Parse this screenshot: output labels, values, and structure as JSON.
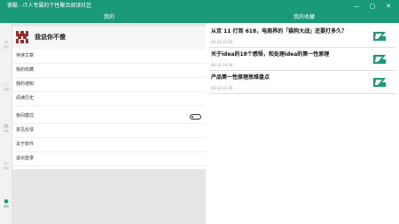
{
  "window": {
    "title": "掌酷 - IT人专属的个性聚合阅读社区",
    "minimize_glyph": "—",
    "maximize_glyph": "▢",
    "close_glyph": "✕"
  },
  "header": {
    "left_title": "我的",
    "right_title": "我的收藏"
  },
  "nav": {
    "items": [
      {
        "label": "首页",
        "icon": "home-icon"
      },
      {
        "label": "发现",
        "icon": "discover-icon"
      },
      {
        "label": "分类",
        "icon": "category-icon"
      },
      {
        "label": "专栏",
        "icon": "column-icon"
      },
      {
        "label": "我的",
        "icon": "user-icon"
      }
    ],
    "glyphs": {
      "home": "⌂",
      "discover": "◌",
      "category": "▤",
      "column": "▭",
      "user": "●"
    }
  },
  "profile": {
    "username": "我说你不傻",
    "avatar_icon": "pixel-avatar-icon",
    "menu_group_1": [
      "待读文章",
      "我的收藏",
      "我的通知",
      "阅读历史"
    ],
    "menu_group_2": [
      "夜间模式",
      "意见反馈",
      "关于软件",
      "退出登录"
    ],
    "night_mode": false
  },
  "favorites": [
    {
      "title": "从双 11 打到 618，电商界的「猫狗大战」还要打多久？",
      "date": "06-18 15:00"
    },
    {
      "title": "关于idea的18个感悟，和处理idea的第一性原理",
      "date": "06-18 14:30"
    },
    {
      "title": "产品第一性原理思维盘点",
      "date": "06-18 11:26"
    }
  ],
  "colors": {
    "accent": "#1a9a76",
    "panel_gray": "#e6e6e6",
    "avatar_red": "#9b2c2c"
  }
}
